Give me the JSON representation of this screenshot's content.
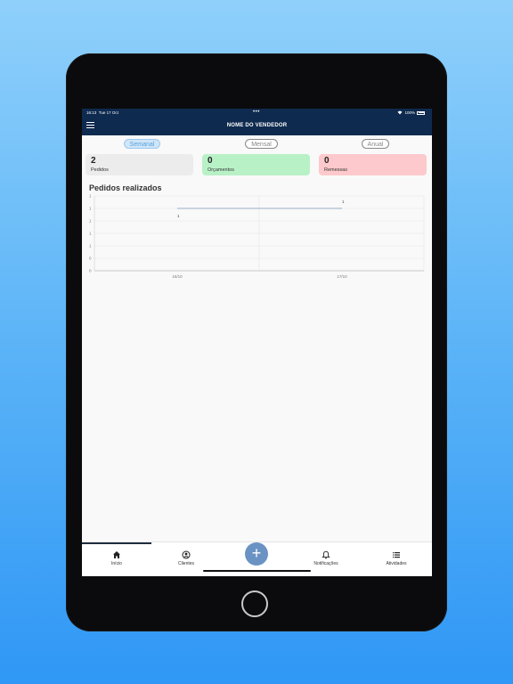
{
  "statusbar": {
    "time": "16:13",
    "date": "Tue 17 Oct",
    "battery": "100%"
  },
  "header": {
    "title": "NOME DO VENDEDOR"
  },
  "periods": [
    {
      "label": "Semanal",
      "active": true
    },
    {
      "label": "Mensal",
      "active": false
    },
    {
      "label": "Anual",
      "active": false
    }
  ],
  "cards": [
    {
      "value": "2",
      "label": "Pedidos",
      "color": "#ececec"
    },
    {
      "value": "0",
      "label": "Orçamentos",
      "color": "#b9f1c7"
    },
    {
      "value": "0",
      "label": "Remessas",
      "color": "#fdc9cc"
    }
  ],
  "chart_title": "Pedidos realizados",
  "chart_data": {
    "type": "line",
    "categories": [
      "16/10",
      "17/10"
    ],
    "series": [
      {
        "values": [
          1,
          1
        ]
      }
    ],
    "data_labels": [
      "1",
      "1"
    ],
    "y_tick_labels": [
      "1",
      "1",
      "1",
      "1",
      "1",
      "0",
      "0"
    ],
    "ylim": [
      0,
      1
    ],
    "grid": true,
    "line_color": "#7b96b8"
  },
  "bottom_nav": [
    {
      "label": "Início",
      "icon": "home-icon"
    },
    {
      "label": "Clientes",
      "icon": "user-circle-icon"
    },
    {
      "label": "Notificações",
      "icon": "bell-icon"
    },
    {
      "label": "Atividades",
      "icon": "list-icon"
    }
  ],
  "fab": {
    "label": "+"
  }
}
